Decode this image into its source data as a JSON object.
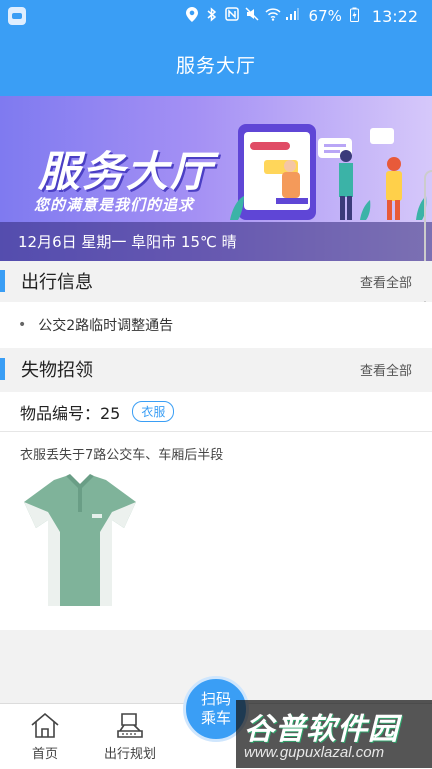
{
  "status_bar": {
    "battery": "67%",
    "time": "13:22"
  },
  "header": {
    "title": "服务大厅"
  },
  "banner": {
    "title": "服务大厅",
    "subtitle": "您的满意是我们的追求",
    "info": "12月6日 星期一 阜阳市 15℃ 晴"
  },
  "travel_info": {
    "title": "出行信息",
    "more": "查看全部",
    "items": [
      {
        "text": "公交2路临时调整通告"
      }
    ]
  },
  "lost_found": {
    "title": "失物招领",
    "more": "查看全部",
    "item": {
      "number_label": "物品编号：25",
      "tag": "衣服",
      "description": "衣服丢失于7路公交车、车厢后半段"
    }
  },
  "tab_bar": {
    "tabs": [
      {
        "label": "首页",
        "icon": "home-icon"
      },
      {
        "label": "出行规划",
        "icon": "route-plan-icon"
      }
    ],
    "scan_button": {
      "line1": "扫码",
      "line2": "乘车"
    }
  },
  "watermark": {
    "big": "谷普软件园",
    "small": "www.gupuxlazal.com"
  },
  "colors": {
    "primary": "#3a9ef5",
    "background": "#f2f2f2"
  }
}
